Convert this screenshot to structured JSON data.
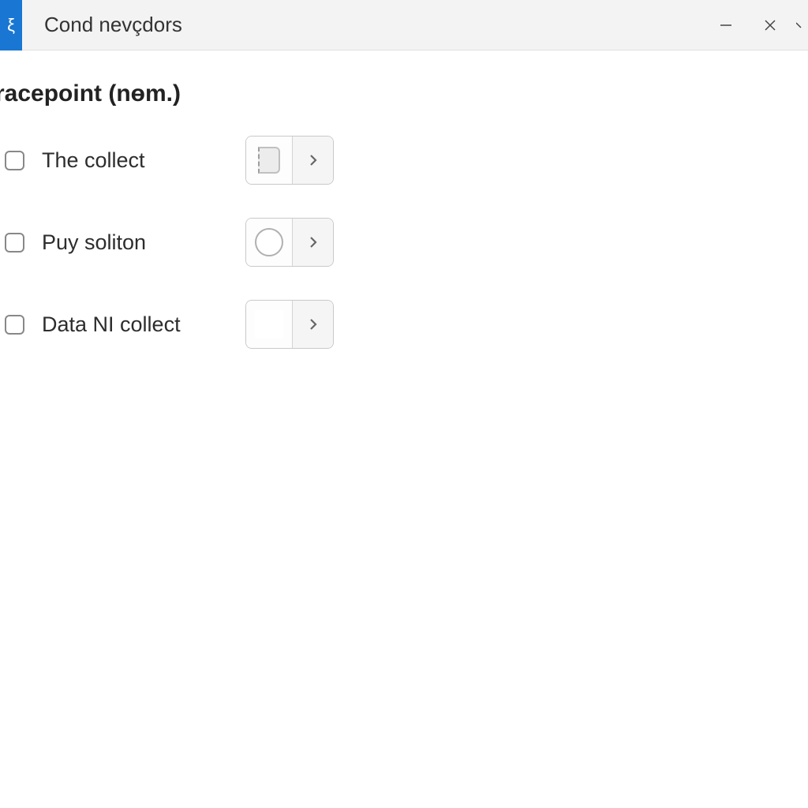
{
  "titlebar": {
    "app_glyph": "ξ",
    "title": "Cond nevçdors"
  },
  "section": {
    "heading": "racepoint (nөm.)"
  },
  "options": [
    {
      "label": "The collect",
      "preview": "rect"
    },
    {
      "label": "Puy soliton",
      "preview": "circle"
    },
    {
      "label": "Data NI collect",
      "preview": "empty"
    }
  ]
}
